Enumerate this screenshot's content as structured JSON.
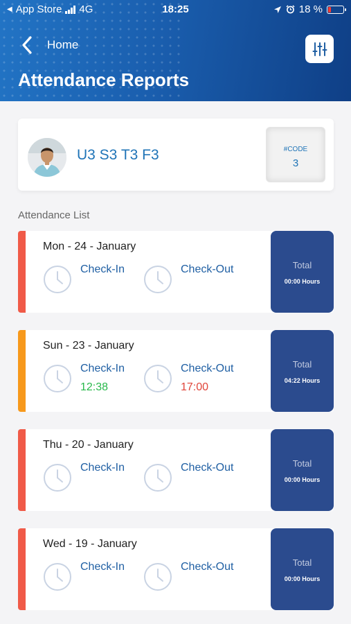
{
  "status_bar": {
    "carrier": "App Store",
    "network": "4G",
    "time": "18:25",
    "battery": "18 %",
    "battery_level": 0.18
  },
  "header": {
    "back_label": "Home",
    "title": "Attendance Reports"
  },
  "profile": {
    "name": "U3 S3 T3 F3",
    "code_label": "#CODE",
    "code_value": "3"
  },
  "list_label": "Attendance List",
  "colors": {
    "header_start": "#2274c5",
    "header_end": "#0f3f86",
    "accent_blue": "#1f74b7",
    "total_bg": "#2b4b8e",
    "absent_red": "#f05a48",
    "partial_orange": "#f7991c",
    "time_in_green": "#27b84a",
    "time_out_red": "#e0453a"
  },
  "attendance": [
    {
      "date": "Mon - 24 - January",
      "status_color": "#f05a48",
      "check_in_label": "Check-In",
      "check_in_time": "",
      "check_out_label": "Check-Out",
      "check_out_time": "",
      "total_label": "Total",
      "total_hours": "00:00 Hours"
    },
    {
      "date": "Sun - 23 - January",
      "status_color": "#f7991c",
      "check_in_label": "Check-In",
      "check_in_time": "12:38",
      "check_out_label": "Check-Out",
      "check_out_time": "17:00",
      "total_label": "Total",
      "total_hours": "04:22 Hours"
    },
    {
      "date": "Thu - 20 - January",
      "status_color": "#f05a48",
      "check_in_label": "Check-In",
      "check_in_time": "",
      "check_out_label": "Check-Out",
      "check_out_time": "",
      "total_label": "Total",
      "total_hours": "00:00 Hours"
    },
    {
      "date": "Wed - 19 - January",
      "status_color": "#f05a48",
      "check_in_label": "Check-In",
      "check_in_time": "",
      "check_out_label": "Check-Out",
      "check_out_time": "",
      "total_label": "Total",
      "total_hours": "00:00 Hours"
    }
  ]
}
